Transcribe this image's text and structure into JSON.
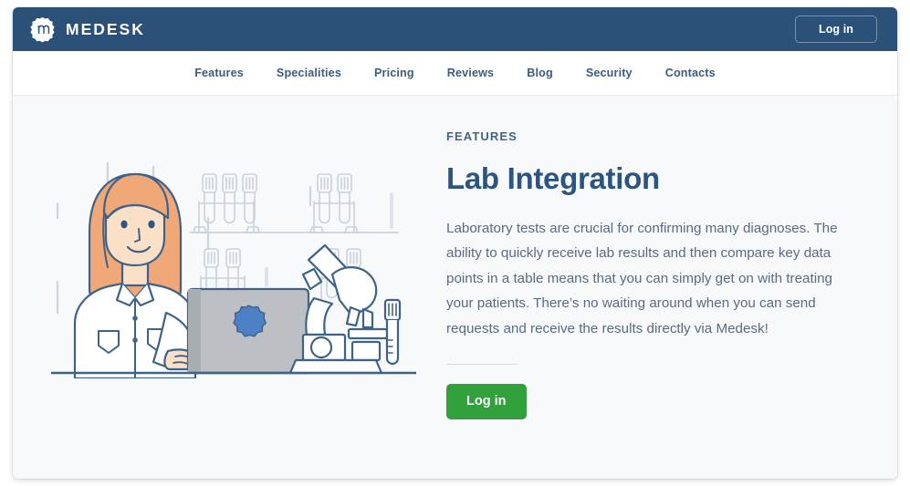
{
  "header": {
    "brand_name": "MEDESK",
    "brand_icon": "medesk-logo-icon",
    "login_label": "Log in",
    "bg_color": "#2b5179"
  },
  "nav": {
    "items": [
      {
        "label": "Features"
      },
      {
        "label": "Specialities"
      },
      {
        "label": "Pricing"
      },
      {
        "label": "Reviews"
      },
      {
        "label": "Blog"
      },
      {
        "label": "Security"
      },
      {
        "label": "Contacts"
      }
    ]
  },
  "hero": {
    "eyebrow": "FEATURES",
    "title": "Lab Integration",
    "paragraph": "Laboratory tests are crucial for confirming many diagnoses. The ability to quickly receive lab results and then compare key data points in a table means that you can simply get on with treating your patients. There’s no waiting around when you can send requests and receive the results directly via Medesk!",
    "cta_label": "Log in",
    "cta_color": "#31a13c",
    "title_color": "#2c5480",
    "illustration_name": "lab-doctor-illustration",
    "illustration_alt": "Female doctor in white lab coat at a laptop with test tube racks and a microscope"
  },
  "page": {
    "background_color": "#f7f9fb"
  }
}
